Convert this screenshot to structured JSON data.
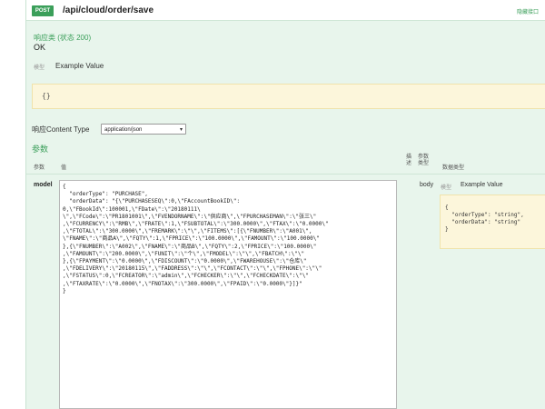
{
  "header": {
    "method": "POST",
    "path": "/api/cloud/order/save",
    "hide_label": "隐藏接口"
  },
  "response": {
    "status": "响应类 (状态 200)",
    "text": "OK",
    "model_tab": "模型",
    "example_tab": "Example Value",
    "example_value": "{}"
  },
  "content_type": {
    "label": "响应Content Type",
    "selected": "application/json"
  },
  "params": {
    "title": "参数",
    "columns": {
      "param": "参数",
      "value": "值",
      "desc": "描述",
      "param_type": "参数类型",
      "data_type": "数据类型"
    },
    "row": {
      "name": "model",
      "type": "body",
      "model_tab": "模型",
      "example_tab": "Example Value",
      "example_value": "{\n  \"orderType\": \"string\",\n  \"orderData\": \"string\"\n}",
      "code": "{\n  \"orderType\": \"PURCHASE\",\n  \"orderData\": \"{\\\"PURCHASESEQ\\\":0,\\\"FAccountBookID\\\":\n0,\\\"FBookId\\\":100001,\\\"FDate\\\":\\\"20180111\\\n\\\",\\\"FCode\\\":\\\"PR1801001\\\",\\\"FVENDORNAME\\\":\\\"供应商\\\",\\\"FPURCHASEMAN\\\":\\\"张三\\\"\n,\\\"FCURRENCY\\\":\\\"RMB\\\",\\\"FRATE\\\":1,\\\"FSUBTOTAL\\\":\\\"300.0000\\\",\\\"FTAX\\\":\\\"0.0000\\\"\n,\\\"FTOTAL\\\":\\\"300.0000\\\",\\\"FREMARK\\\":\\\"\\\",\\\"FITEMS\\\":[{\\\"FNUMBER\\\":\\\"A001\\\",\n\\\"FNAME\\\":\\\"商品A\\\",\\\"FQTY\\\":1,\\\"FPRICE\\\":\\\"100.0000\\\",\\\"FAMOUNT\\\":\\\"100.0000\\\"\n},{\\\"FNUMBER\\\":\\\"A002\\\",\\\"FNAME\\\":\\\"商品B\\\",\\\"FQTY\\\":2,\\\"FPRICE\\\":\\\"100.0000\\\"\n,\\\"FAMOUNT\\\":\\\"200.0000\\\",\\\"FUNIT\\\":\\\"个\\\",\\\"FMODEL\\\":\\\"\\\",\\\"FBATCH\\\":\\\"\\\"\n},{\\\"FPAYMENT\\\":\\\"0.0000\\\",\\\"FDISCOUNT\\\":\\\"0.0000\\\",\\\"FWAREHOUSE\\\":\\\"仓库\\\"\n,\\\"FDELIVERY\\\":\\\"20180115\\\",\\\"FADDRESS\\\":\\\"\\\",\\\"FCONTACT\\\":\\\"\\\",\\\"FPHONE\\\":\\\"\\\"\n,\\\"FSTATUS\\\":0,\\\"FCREATOR\\\":\\\"admin\\\",\\\"FCHECKER\\\":\\\"\\\",\\\"FCHECKDATE\\\":\\\"\\\"\n,\\\"FTAXRATE\\\":\\\"0.0000\\\",\\\"FNOTAX\\\":\\\"300.0000\\\",\\\"FPAID\\\":\\\"0.0000\\\"}]}\"\n}"
    }
  }
}
